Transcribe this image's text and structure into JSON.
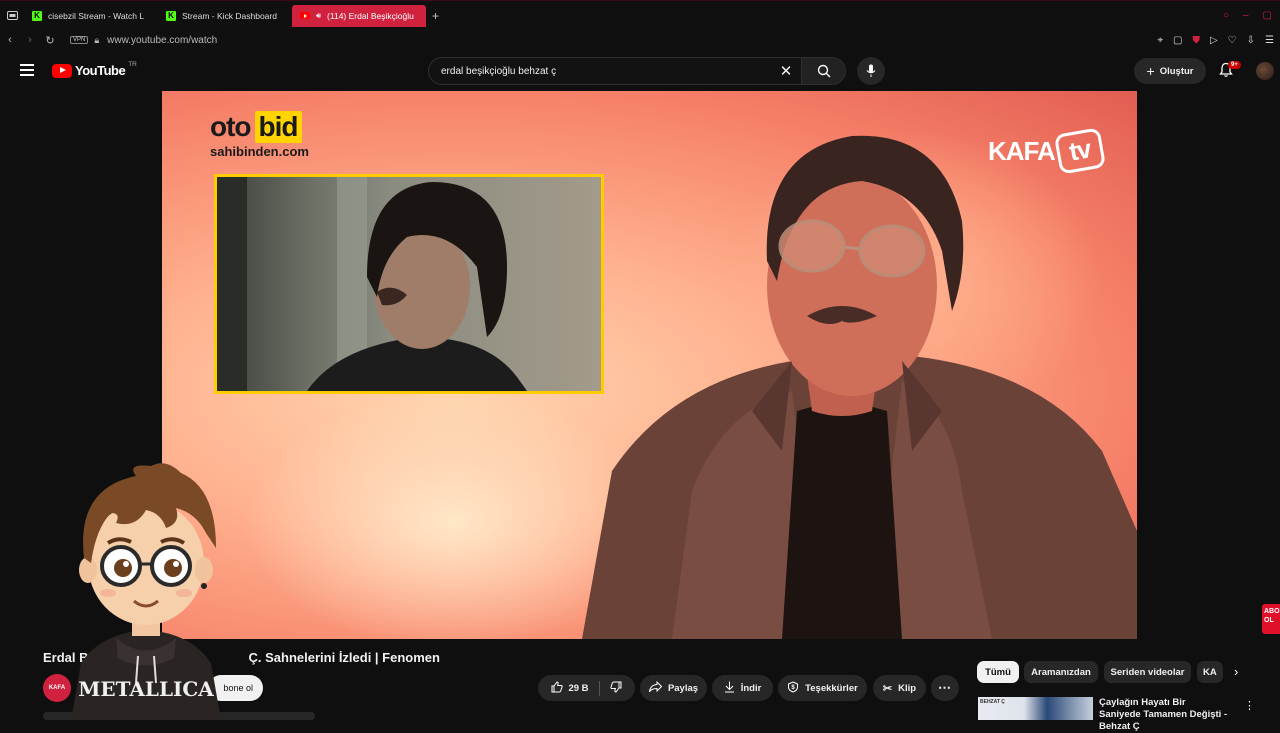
{
  "browser": {
    "tabs": [
      {
        "title": "cisebzil Stream - Watch L"
      },
      {
        "title": "Stream - Kick Dashboard"
      },
      {
        "title": "(114) Erdal Beşikçioğlu"
      }
    ],
    "address": {
      "vpn_label": "VPN",
      "url": "www.youtube.com/watch"
    }
  },
  "youtube": {
    "logo_text": "YouTube",
    "country_code": "TR",
    "search": {
      "value": "erdal beşikçioğlu behzat ç"
    },
    "create_label": "Oluştur",
    "notification_count": "9+"
  },
  "video_overlay": {
    "sponsor_name_a": "oto",
    "sponsor_name_b": "bid",
    "sponsor_domain": "sahibinden.com",
    "channel_logo_a": "KAFA",
    "channel_logo_b": "tv"
  },
  "video": {
    "title_left": "Erdal B",
    "title_right": "Ç. Sahnelerini İzledi | Fenomen",
    "subscribe_label": "bone ol",
    "channel_avatar_text": "KAFA",
    "likes": "29 B",
    "share_label": "Paylaş",
    "download_label": "İndir",
    "thanks_label": "Teşekkürler",
    "clip_label": "Klip"
  },
  "chips": [
    {
      "label": "Tümü",
      "selected": true
    },
    {
      "label": "Aramanızdan"
    },
    {
      "label": "Seriden videolar"
    },
    {
      "label": "KA"
    }
  ],
  "recommendation": {
    "thumb_label": "BEHZAT Ç",
    "title": "Çaylağın Hayatı Bir Saniyede Tamamen Değişti - Behzat Ç"
  },
  "edge_badge": "ABO\nOL",
  "cartoon": {
    "hoodie_text": "METALLICA"
  },
  "colors": {
    "accent": "#d0223f",
    "youtube_red": "#ff0000",
    "kick_green": "#53fc18",
    "otobid_yellow": "#ffd400"
  }
}
